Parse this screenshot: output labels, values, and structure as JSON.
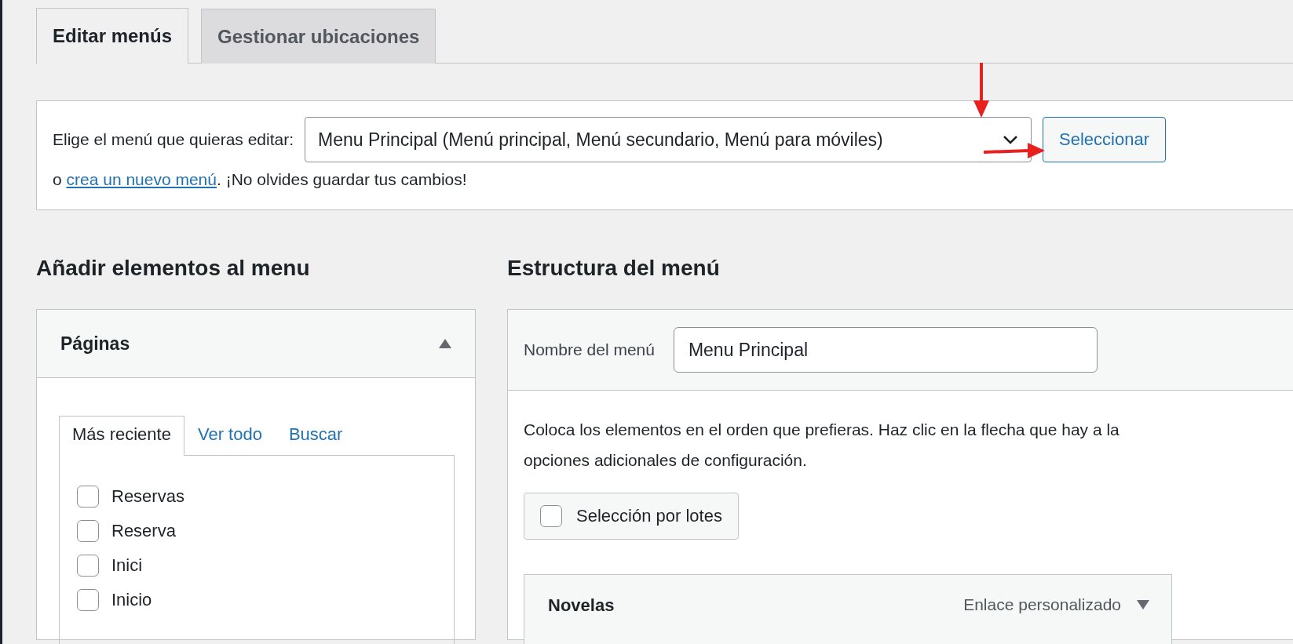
{
  "tabs": [
    {
      "label": "Editar menús",
      "selected": true
    },
    {
      "label": "Gestionar ubicaciones",
      "selected": false
    }
  ],
  "menu_select": {
    "label": "Elige el menú que quieras editar:",
    "value": "Menu Principal (Menú principal, Menú secundario, Menú para móviles)",
    "button": "Seleccionar",
    "note_prefix": "o ",
    "link": "crea un nuevo menú",
    "note_suffix": ". ¡No olvides guardar tus cambios!"
  },
  "add_items": {
    "heading": "Añadir elementos al menu",
    "panel": {
      "title": "Páginas",
      "expanded": true,
      "tabs": [
        {
          "label": "Más reciente",
          "selected": true
        },
        {
          "label": "Ver todo",
          "selected": false
        },
        {
          "label": "Buscar",
          "selected": false
        }
      ],
      "pages": [
        {
          "label": "Reservas",
          "checked": false
        },
        {
          "label": "Reserva",
          "checked": false
        },
        {
          "label": "Inici",
          "checked": false
        },
        {
          "label": "Inicio",
          "checked": false
        }
      ]
    }
  },
  "structure": {
    "heading": "Estructura del menú",
    "name_label": "Nombre del menú",
    "name_value": "Menu Principal",
    "instructions": [
      "Coloca los elementos en el orden que prefieras. Haz clic en la flecha que hay a la",
      "opciones adicionales de configuración."
    ],
    "bulk_select": {
      "label": "Selección por lotes",
      "checked": false
    },
    "items": [
      {
        "title": "Novelas",
        "type": "Enlace personalizado",
        "expanded": false
      }
    ]
  }
}
